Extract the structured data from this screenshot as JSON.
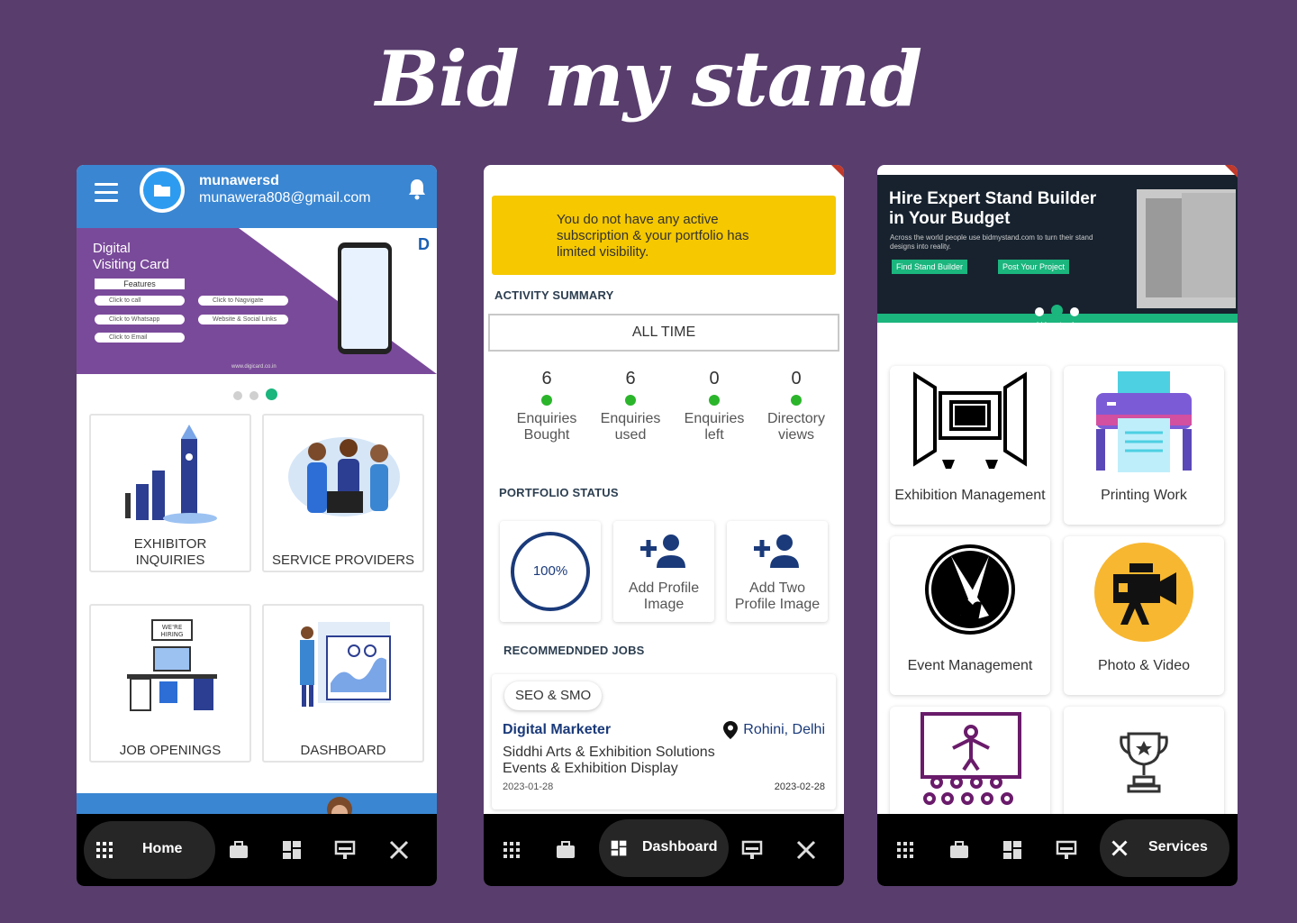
{
  "title": "Bid my stand",
  "phone1": {
    "user_name": "munawersd",
    "user_email": "munawera808@gmail.com",
    "banner": {
      "title_line1": "Digital",
      "title_line2": "Visiting Card",
      "features_label": "Features",
      "chips": [
        "Click to call",
        "Click to Whatsapp",
        "Click to Email",
        "Click to Nagvigate",
        "Website & Social Links"
      ],
      "url": "www.digicard.co.in"
    },
    "cards": [
      {
        "line1": "EXHIBITOR",
        "line2": "INQUIRIES"
      },
      {
        "line1": "SERVICE PROVIDERS",
        "line2": ""
      },
      {
        "line1": "JOB OPENINGS",
        "line2": ""
      },
      {
        "line1": "DASHBOARD",
        "line2": ""
      }
    ],
    "hiring_sign": "WE'RE HIRING",
    "nav_active": "Home"
  },
  "phone2": {
    "alert": "You do not have any active subscription & your portfolio has limited visibility.",
    "activity_summary": "ACTIVITY SUMMARY",
    "all_time": "ALL TIME",
    "stats": [
      {
        "value": "6",
        "l1": "Enquiries",
        "l2": "Bought"
      },
      {
        "value": "6",
        "l1": "Enquiries",
        "l2": "used"
      },
      {
        "value": "0",
        "l1": "Enquiries",
        "l2": "left"
      },
      {
        "value": "0",
        "l1": "Directory",
        "l2": "views"
      }
    ],
    "portfolio_status": "PORTFOLIO STATUS",
    "progress": "100%",
    "add_profile": {
      "l1": "Add Profile",
      "l2": "Image"
    },
    "add_two": {
      "l1": "Add Two",
      "l2": "Profile Image"
    },
    "recommended_jobs": "RECOMMEDNDED JOBS",
    "job": {
      "tag": "SEO & SMO",
      "title": "Digital Marketer",
      "location": "Rohini, Delhi",
      "company": "Siddhi Arts & Exhibition Solutions",
      "category": "Events & Exhibition Display",
      "start": "2023-01-28",
      "end": "2023-02-28"
    },
    "nav_active": "Dashboard"
  },
  "phone3": {
    "banner": {
      "title_line1": "Hire Expert Stand Builder",
      "title_line2": "in Your Budget",
      "subtitle": "Across the world people use bidmystand.com to turn their stand designs into reality.",
      "btn1": "Find Stand Builder",
      "btn2": "Post Your Project",
      "url": "www.bidmystand.com"
    },
    "services": [
      "Exhibition Management",
      "Printing Work",
      "Event Management",
      "Photo & Video"
    ],
    "nav_active": "Services"
  },
  "colors": {
    "background": "#583d6d",
    "header_blue": "#3a86d2",
    "accent_green": "#1bb57e",
    "alert_yellow": "#f5c800",
    "navy": "#1a3a7a"
  }
}
